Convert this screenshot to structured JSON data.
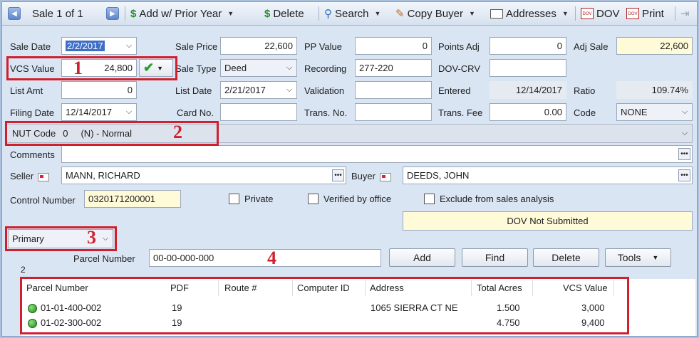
{
  "toolbar": {
    "record_label": "Sale 1 of 1",
    "add_prior_year": "Add w/ Prior Year",
    "delete": "Delete",
    "search": "Search",
    "copy_buyer": "Copy Buyer",
    "addresses": "Addresses",
    "dov": "DOV",
    "print": "Print"
  },
  "form": {
    "sale_date_label": "Sale Date",
    "sale_date": "2/2/2017",
    "sale_price_label": "Sale Price",
    "sale_price": "22,600",
    "pp_value_label": "PP Value",
    "pp_value": "0",
    "points_adj_label": "Points Adj",
    "points_adj": "0",
    "adj_sale_label": "Adj Sale",
    "adj_sale": "22,600",
    "vcs_value_label": "VCS Value",
    "vcs_value": "24,800",
    "sale_type_label": "Sale Type",
    "sale_type": "Deed",
    "recording_label": "Recording",
    "recording": "277-220",
    "dov_crv_label": "DOV-CRV",
    "dov_crv": "",
    "list_amt_label": "List Amt",
    "list_amt": "0",
    "list_date_label": "List Date",
    "list_date": "2/21/2017",
    "validation_label": "Validation",
    "validation": "",
    "entered_label": "Entered",
    "entered": "12/14/2017",
    "ratio_label": "Ratio",
    "ratio": "109.74%",
    "filing_date_label": "Filing Date",
    "filing_date": "12/14/2017",
    "card_no_label": "Card No.",
    "card_no": "",
    "trans_no_label": "Trans. No.",
    "trans_no": "",
    "trans_fee_label": "Trans. Fee",
    "trans_fee": "0.00",
    "code_label": "Code",
    "code": "NONE",
    "nut_code_label": "NUT Code",
    "nut_code": "0     (N) - Normal",
    "comments_label": "Comments",
    "comments": "",
    "seller_label": "Seller",
    "seller": "MANN, RICHARD",
    "buyer_label": "Buyer",
    "buyer": "DEEDS, JOHN",
    "control_number_label": "Control Number",
    "control_number": "0320171200001",
    "private_label": "Private",
    "verified_label": "Verified by office",
    "exclude_label": "Exclude from sales analysis",
    "dov_status": "DOV Not Submitted"
  },
  "parcel": {
    "selector": "Primary",
    "parcel_number_label": "Parcel Number",
    "parcel_number": "00-00-000-000",
    "add": "Add",
    "find": "Find",
    "delete": "Delete",
    "tools": "Tools",
    "count": "2"
  },
  "grid": {
    "headers": [
      "Parcel Number",
      "PDF",
      "Route #",
      "Computer ID",
      "Address",
      "Total Acres",
      "VCS Value"
    ],
    "rows": [
      [
        "01-01-400-002",
        "19",
        "",
        "",
        "1065 SIERRA CT NE",
        "1.500",
        "3,000"
      ],
      [
        "01-02-300-002",
        "19",
        "",
        "",
        "",
        "4.750",
        "9,400"
      ]
    ]
  },
  "callouts": [
    "1",
    "2",
    "3",
    "4"
  ],
  "colors": {
    "callout_red": "#d0202e",
    "selection_blue": "#3d6fc7",
    "status_green": "#1f8a1f",
    "panel": "#dae5f3"
  }
}
